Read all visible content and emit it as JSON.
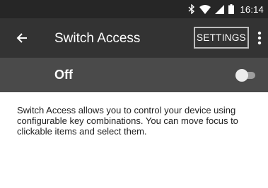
{
  "status_bar": {
    "time": "16:14",
    "icons": [
      "bluetooth-icon",
      "wifi-icon",
      "signal-icon",
      "battery-icon"
    ]
  },
  "app_bar": {
    "title": "Switch Access",
    "back_icon": "arrow-back-icon",
    "settings_label": "SETTINGS",
    "overflow_icon": "more-vert-icon"
  },
  "switch_bar": {
    "label": "Off",
    "toggle_on": false
  },
  "description": "Switch Access allows you to control your device using configurable key combinations. You can move focus to clickable items and select them.",
  "colors": {
    "status_bar": "#262626",
    "app_bar": "#333333",
    "switch_bar": "#4a4a4a",
    "text_on_dark": "#ffffff"
  }
}
